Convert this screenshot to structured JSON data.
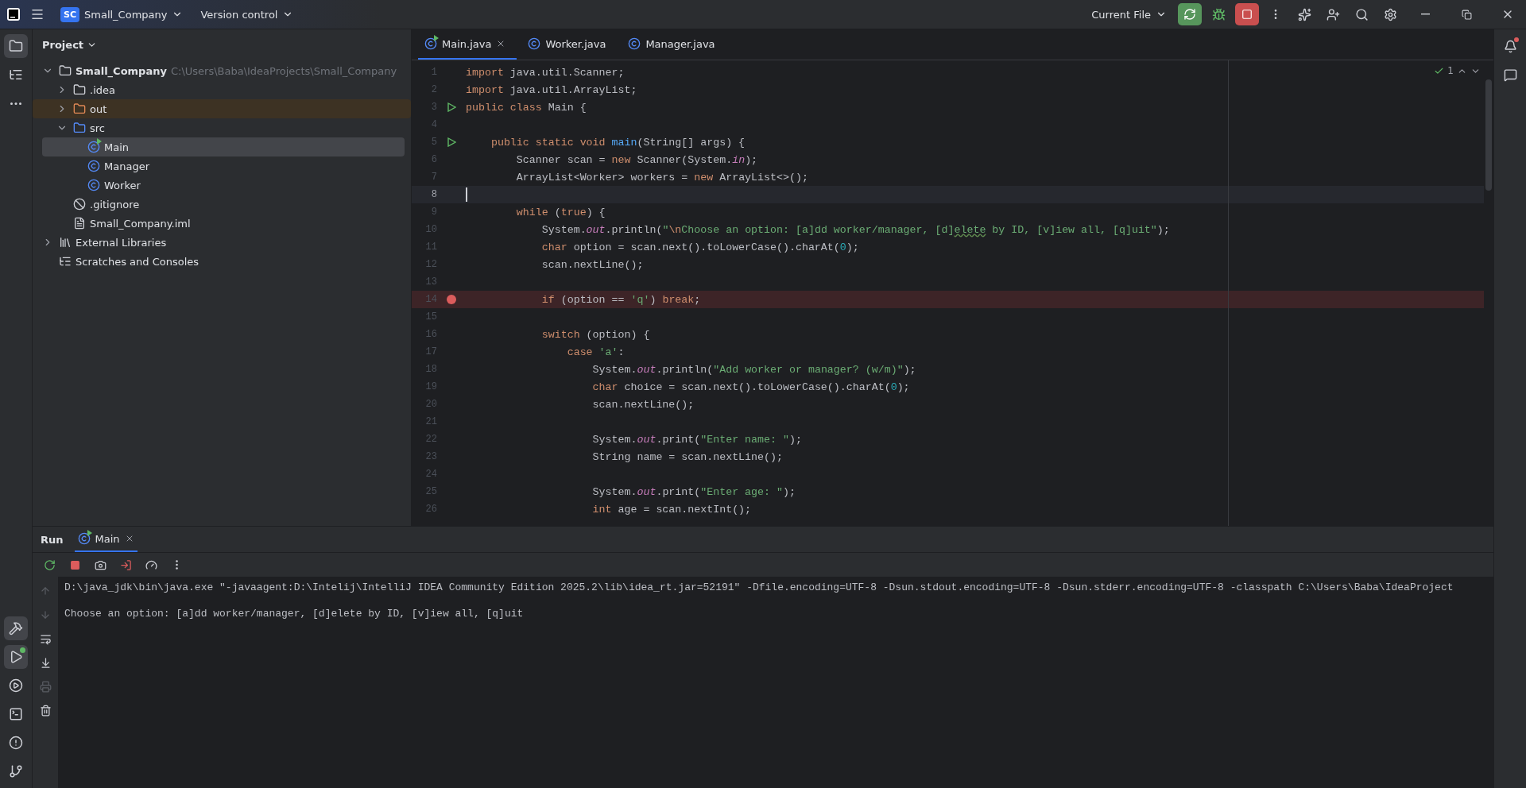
{
  "title_bar": {
    "project_badge": "SC",
    "project": "Small_Company",
    "vcs": "Version control",
    "run_config": "Current File"
  },
  "project_panel": {
    "title": "Project",
    "tree": [
      {
        "label": "Small_Company",
        "hint": "C:\\Users\\Baba\\IdeaProjects\\Small_Company",
        "kind": "module",
        "expanded": true,
        "selected": false,
        "excluded": false,
        "children": [
          {
            "label": ".idea",
            "kind": "folder",
            "expanded": false,
            "selected": false,
            "excluded": false
          },
          {
            "label": "out",
            "kind": "excluded-folder",
            "expanded": false,
            "selected": false,
            "excluded": true
          },
          {
            "label": "src",
            "kind": "source-folder",
            "expanded": true,
            "selected": false,
            "excluded": false,
            "children": [
              {
                "label": "Main",
                "kind": "main-class",
                "selected": true,
                "excluded": false
              },
              {
                "label": "Manager",
                "kind": "class",
                "selected": false,
                "excluded": false
              },
              {
                "label": "Worker",
                "kind": "class",
                "selected": false,
                "excluded": false
              }
            ]
          },
          {
            "label": ".gitignore",
            "kind": "ignore",
            "selected": false,
            "excluded": false
          },
          {
            "label": "Small_Company.iml",
            "kind": "iml",
            "selected": false,
            "excluded": false
          }
        ]
      },
      {
        "label": "External Libraries",
        "kind": "libraries",
        "expanded": false,
        "selected": false,
        "excluded": false
      },
      {
        "label": "Scratches and Consoles",
        "kind": "scratches",
        "selected": false,
        "excluded": false
      }
    ]
  },
  "editor": {
    "tabs": [
      {
        "label": "Main.java",
        "kind": "main-class",
        "selected": true
      },
      {
        "label": "Worker.java",
        "kind": "class",
        "selected": false
      },
      {
        "label": "Manager.java",
        "kind": "class",
        "selected": false
      }
    ],
    "inspections": "1",
    "lines": [
      {
        "number": "1",
        "run": false,
        "breakpoint": false,
        "current": false,
        "segs": [
          {
            "text": "import",
            "kind": "keyword"
          },
          {
            "text": " java.util.Scanner;",
            "kind": "plain"
          }
        ]
      },
      {
        "number": "2",
        "run": false,
        "breakpoint": false,
        "current": false,
        "segs": [
          {
            "text": "import",
            "kind": "keyword"
          },
          {
            "text": " java.util.ArrayList;",
            "kind": "plain"
          }
        ]
      },
      {
        "number": "3",
        "run": true,
        "breakpoint": false,
        "current": false,
        "segs": [
          {
            "text": "public class",
            "kind": "keyword"
          },
          {
            "text": " Main {",
            "kind": "plain"
          }
        ]
      },
      {
        "number": "4",
        "run": false,
        "breakpoint": false,
        "current": false
      },
      {
        "number": "5",
        "run": true,
        "breakpoint": false,
        "current": false,
        "segs": [
          {
            "text": "    public static void ",
            "kind": "keyword"
          },
          {
            "text": "main",
            "kind": "method"
          },
          {
            "text": "(String[] args) {",
            "kind": "plain"
          }
        ]
      },
      {
        "number": "6",
        "run": false,
        "breakpoint": false,
        "current": false,
        "segs": [
          {
            "text": "        Scanner scan = ",
            "kind": "plain"
          },
          {
            "text": "new",
            "kind": "keyword"
          },
          {
            "text": " Scanner(System.",
            "kind": "plain"
          },
          {
            "text": "in",
            "kind": "field"
          },
          {
            "text": ");",
            "kind": "plain"
          }
        ]
      },
      {
        "number": "7",
        "run": false,
        "breakpoint": false,
        "current": false,
        "segs": [
          {
            "text": "        ArrayList<Worker> workers = ",
            "kind": "plain"
          },
          {
            "text": "new",
            "kind": "keyword"
          },
          {
            "text": " ArrayList<>();",
            "kind": "plain"
          }
        ]
      },
      {
        "number": "8",
        "run": false,
        "breakpoint": false,
        "current": true
      },
      {
        "number": "9",
        "run": false,
        "breakpoint": false,
        "current": false,
        "segs": [
          {
            "text": "        while",
            "kind": "keyword"
          },
          {
            "text": " (",
            "kind": "plain"
          },
          {
            "text": "true",
            "kind": "keyword"
          },
          {
            "text": ") {",
            "kind": "plain"
          }
        ]
      },
      {
        "number": "10",
        "run": false,
        "breakpoint": false,
        "current": false,
        "segs": [
          {
            "text": "            System.",
            "kind": "plain"
          },
          {
            "text": "out",
            "kind": "field"
          },
          {
            "text": ".println(",
            "kind": "plain"
          },
          {
            "text": "\"",
            "kind": "string"
          },
          {
            "text": "\\n",
            "kind": "keyword"
          },
          {
            "text": "Choose an option: [a]dd worker/manager, [d]",
            "kind": "string"
          },
          {
            "text": "elete",
            "kind": "typo"
          },
          {
            "text": " by ID, [v]iew all, [q]uit\"",
            "kind": "string"
          },
          {
            "text": ");",
            "kind": "plain"
          }
        ]
      },
      {
        "number": "11",
        "run": false,
        "breakpoint": false,
        "current": false,
        "segs": [
          {
            "text": "            char",
            "kind": "keyword"
          },
          {
            "text": " option = scan.next().toLowerCase().charAt(",
            "kind": "plain"
          },
          {
            "text": "0",
            "kind": "number"
          },
          {
            "text": ");",
            "kind": "plain"
          }
        ]
      },
      {
        "number": "12",
        "run": false,
        "breakpoint": false,
        "current": false,
        "segs": [
          {
            "text": "            scan.nextLine();",
            "kind": "plain"
          }
        ]
      },
      {
        "number": "13",
        "run": false,
        "breakpoint": false,
        "current": false
      },
      {
        "number": "14",
        "run": false,
        "breakpoint": true,
        "current": false,
        "segs": [
          {
            "text": "            if",
            "kind": "keyword"
          },
          {
            "text": " (option == ",
            "kind": "plain"
          },
          {
            "text": "'q'",
            "kind": "string"
          },
          {
            "text": ") ",
            "kind": "plain"
          },
          {
            "text": "break",
            "kind": "keyword"
          },
          {
            "text": ";",
            "kind": "plain"
          }
        ]
      },
      {
        "number": "15",
        "run": false,
        "breakpoint": false,
        "current": false
      },
      {
        "number": "16",
        "run": false,
        "breakpoint": false,
        "current": false,
        "segs": [
          {
            "text": "            switch",
            "kind": "keyword"
          },
          {
            "text": " (option) {",
            "kind": "plain"
          }
        ]
      },
      {
        "number": "17",
        "run": false,
        "breakpoint": false,
        "current": false,
        "segs": [
          {
            "text": "                case ",
            "kind": "keyword"
          },
          {
            "text": "'a'",
            "kind": "string"
          },
          {
            "text": ":",
            "kind": "plain"
          }
        ]
      },
      {
        "number": "18",
        "run": false,
        "breakpoint": false,
        "current": false,
        "segs": [
          {
            "text": "                    System.",
            "kind": "plain"
          },
          {
            "text": "out",
            "kind": "field"
          },
          {
            "text": ".println(",
            "kind": "plain"
          },
          {
            "text": "\"Add worker or manager? (w/m)\"",
            "kind": "string"
          },
          {
            "text": ");",
            "kind": "plain"
          }
        ]
      },
      {
        "number": "19",
        "run": false,
        "breakpoint": false,
        "current": false,
        "segs": [
          {
            "text": "                    char",
            "kind": "keyword"
          },
          {
            "text": " choice = scan.next().toLowerCase().charAt(",
            "kind": "plain"
          },
          {
            "text": "0",
            "kind": "number"
          },
          {
            "text": ");",
            "kind": "plain"
          }
        ]
      },
      {
        "number": "20",
        "run": false,
        "breakpoint": false,
        "current": false,
        "segs": [
          {
            "text": "                    scan.nextLine();",
            "kind": "plain"
          }
        ]
      },
      {
        "number": "21",
        "run": false,
        "breakpoint": false,
        "current": false
      },
      {
        "number": "22",
        "run": false,
        "breakpoint": false,
        "current": false,
        "segs": [
          {
            "text": "                    System.",
            "kind": "plain"
          },
          {
            "text": "out",
            "kind": "field"
          },
          {
            "text": ".print(",
            "kind": "plain"
          },
          {
            "text": "\"Enter name: \"",
            "kind": "string"
          },
          {
            "text": ");",
            "kind": "plain"
          }
        ]
      },
      {
        "number": "23",
        "run": false,
        "breakpoint": false,
        "current": false,
        "segs": [
          {
            "text": "                    String name = scan.nextLine();",
            "kind": "plain"
          }
        ]
      },
      {
        "number": "24",
        "run": false,
        "breakpoint": false,
        "current": false
      },
      {
        "number": "25",
        "run": false,
        "breakpoint": false,
        "current": false,
        "segs": [
          {
            "text": "                    System.",
            "kind": "plain"
          },
          {
            "text": "out",
            "kind": "field"
          },
          {
            "text": ".print(",
            "kind": "plain"
          },
          {
            "text": "\"Enter age: \"",
            "kind": "string"
          },
          {
            "text": ");",
            "kind": "plain"
          }
        ]
      },
      {
        "number": "26",
        "run": false,
        "breakpoint": false,
        "current": false,
        "segs": [
          {
            "text": "                    int",
            "kind": "keyword"
          },
          {
            "text": " age = scan.nextInt();",
            "kind": "plain"
          }
        ]
      }
    ]
  },
  "run_panel": {
    "title": "Run",
    "tabs": [
      {
        "label": "Main",
        "selected": true
      }
    ],
    "console": [
      {
        "text": "D:\\java_jdk\\bin\\java.exe \"-javaagent:D:\\Intelij\\IntelliJ IDEA Community Edition 2025.2\\lib\\idea_rt.jar=52191\" -Dfile.encoding=UTF-8 -Dsun.stdout.encoding=UTF-8 -Dsun.stderr.encoding=UTF-8 -classpath C:\\Users\\Baba\\IdeaProject"
      },
      {
        "text": "Choose an option: [a]dd worker/manager, [d]elete by ID, [v]iew all, [q]uit"
      }
    ]
  }
}
